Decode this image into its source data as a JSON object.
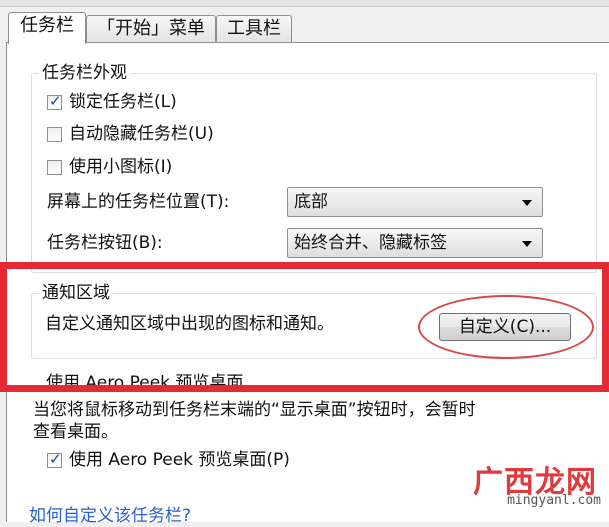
{
  "tabs": [
    {
      "label": "任务栏"
    },
    {
      "label": "「开始」菜单"
    },
    {
      "label": "工具栏"
    }
  ],
  "appearance": {
    "title": "任务栏外观",
    "lock": {
      "label": "锁定任务栏(L)",
      "checked": true
    },
    "autohide": {
      "label": "自动隐藏任务栏(U)",
      "checked": false
    },
    "small_icons": {
      "label": "使用小图标(I)",
      "checked": false
    },
    "position_label": "屏幕上的任务栏位置(T):",
    "position_value": "底部",
    "buttons_label": "任务栏按钮(B):",
    "buttons_value": "始终合并、隐藏标签"
  },
  "notify": {
    "title": "通知区域",
    "desc": "自定义通知区域中出现的图标和通知。",
    "button": "自定义(C)..."
  },
  "peek": {
    "title": "使用 Aero Peek 预览桌面",
    "desc_line1": "当您将鼠标移动到任务栏末端的“显示桌面”按钮时，会暂时",
    "desc_line2": "查看桌面。",
    "checkbox": {
      "label": "使用 Aero Peek 预览桌面(P)",
      "checked": true
    }
  },
  "link": "如何自定义该任务栏?",
  "watermark": {
    "cn": "广西龙网",
    "en": "mingyanl.com"
  },
  "colors": {
    "highlight": "#e42a34",
    "link": "#2a62c7"
  }
}
